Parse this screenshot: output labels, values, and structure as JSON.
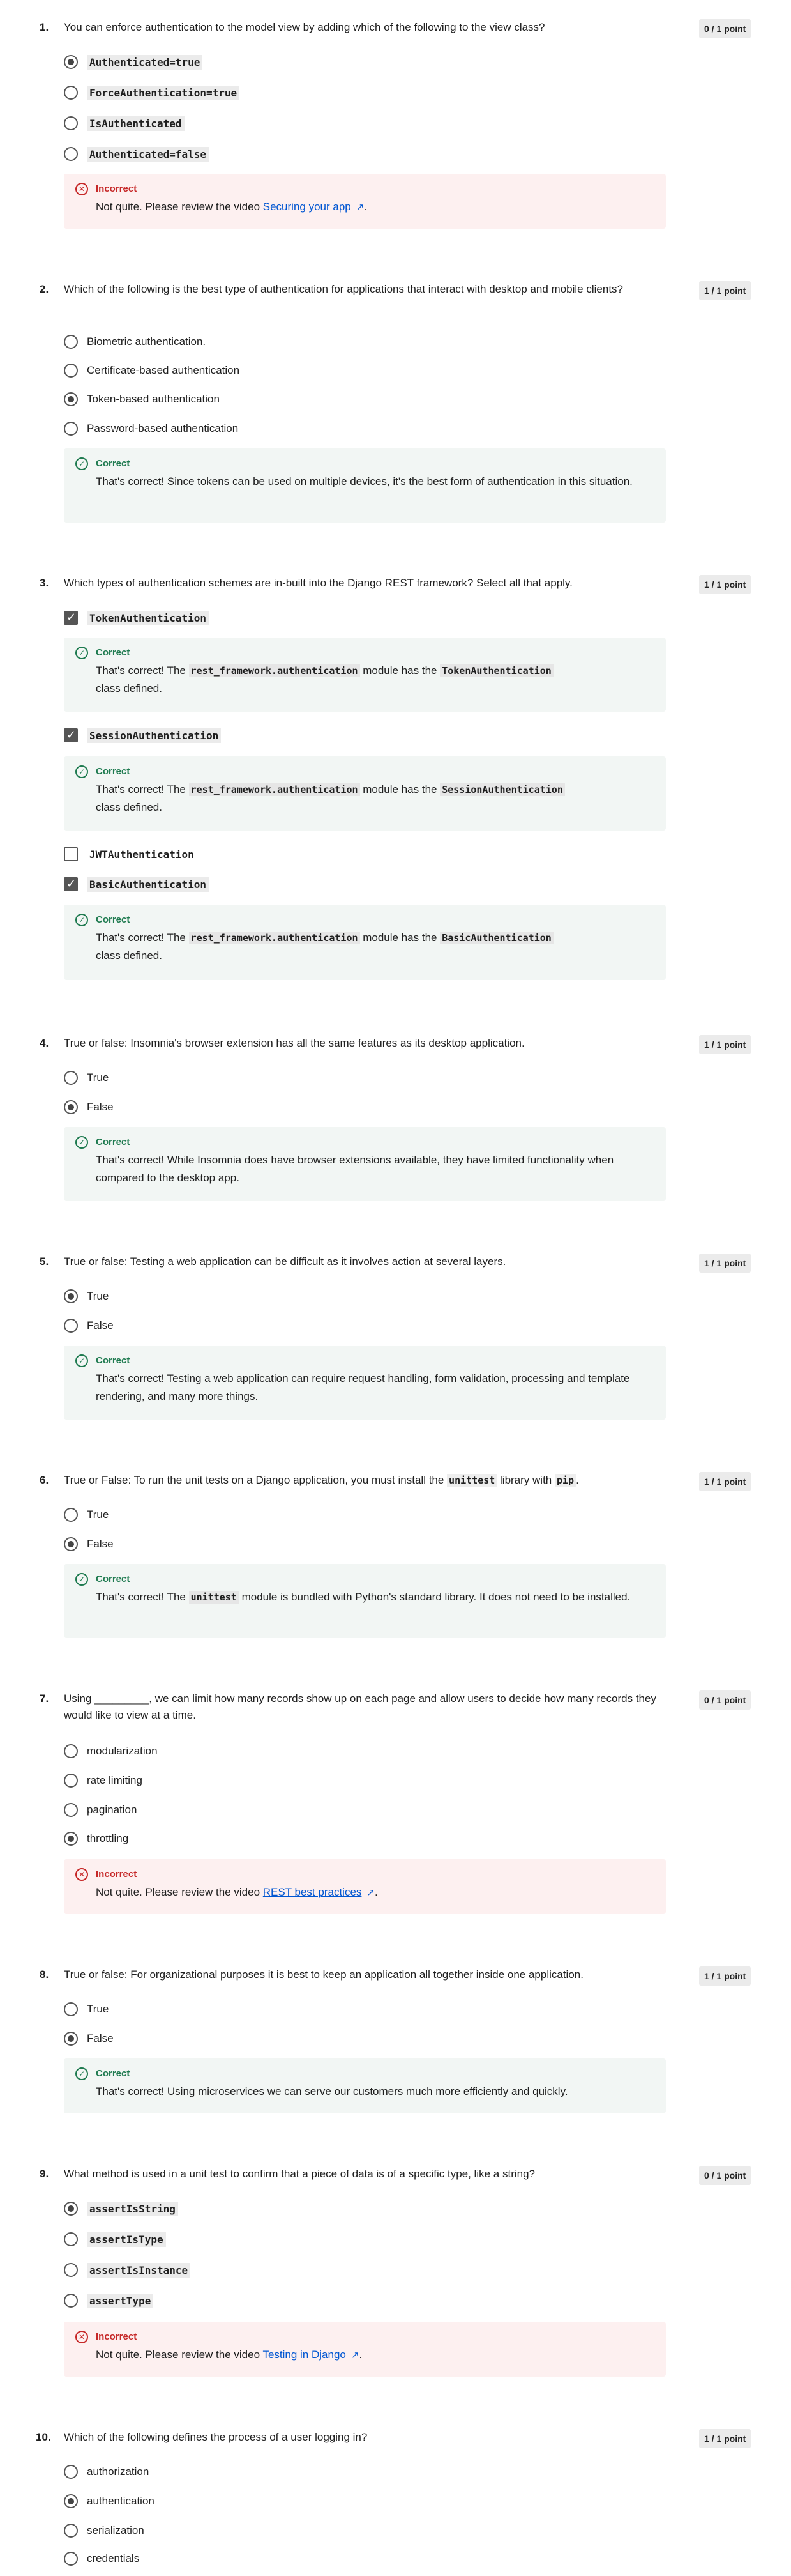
{
  "colors": {
    "correct": "#1e7a4f",
    "incorrect": "#c62828",
    "link": "#0056d2"
  },
  "questions": [
    {
      "num": "1.",
      "text": "You can enforce authentication to the model view by adding which of the following to the view class?",
      "points": "0 / 1 point",
      "options": [
        "Authenticated=true",
        "ForceAuthentication=true",
        "IsAuthenticated",
        "Authenticated=false"
      ],
      "selected": "Authenticated=true",
      "feedback": {
        "title": "Incorrect",
        "msg_prefix": "Not quite. Please review the video ",
        "link": "Securing your app",
        "msg_suffix": "."
      }
    },
    {
      "num": "2.",
      "text": "Which of the following is the best type of authentication for applications that interact with desktop and mobile clients?",
      "points": "1 / 1 point",
      "options": [
        "Biometric authentication.",
        "Certificate-based authentication",
        "Token-based authentication",
        "Password-based authentication"
      ],
      "selected": "Token-based authentication",
      "feedback": {
        "title": "Correct",
        "msg": "That's correct! Since tokens can be used on multiple devices, it's the best form of authentication in this situation."
      }
    },
    {
      "num": "3.",
      "text": "Which types of authentication schemes are in-built into the Django REST framework? Select all that apply.",
      "points": "1 / 1 point",
      "options": [
        "TokenAuthentication",
        "SessionAuthentication",
        "JWTAuthentication",
        "BasicAuthentication"
      ],
      "checked": [
        "TokenAuthentication",
        "SessionAuthentication",
        "BasicAuthentication"
      ],
      "feedback_title": "Correct",
      "feedback_prefix": "That's correct! The ",
      "feedback_module": "rest_framework.authentication",
      "feedback_middle": " module has the ",
      "feedback_suffix": "class defined."
    },
    {
      "num": "4.",
      "text": "True or false: Insomnia's browser extension has all the same features as its desktop application.",
      "points": "1 / 1 point",
      "options": [
        "True",
        "False"
      ],
      "selected": "False",
      "feedback": {
        "title": "Correct",
        "msg": "That's correct! While Insomnia does have browser extensions available, they have limited functionality when compared to the desktop app."
      }
    },
    {
      "num": "5.",
      "text": "True or false: Testing a web application can be difficult as it involves action at several layers.",
      "points": "1 / 1 point",
      "options": [
        "True",
        "False"
      ],
      "selected": "True",
      "feedback": {
        "title": "Correct",
        "msg": "That's correct! Testing a web application can require request handling, form validation, processing and template rendering, and many more things."
      }
    },
    {
      "num": "6.",
      "text_prefix": "True or False:  To run the unit tests on a Django application, you must install the ",
      "text_code1": "unittest",
      "text_middle": " library with ",
      "text_code2": "pip",
      "text_suffix": ".",
      "points": "1 / 1 point",
      "options": [
        "True",
        "False"
      ],
      "selected": "False",
      "feedback": {
        "title": "Correct",
        "msg_prefix": "That's correct! The ",
        "msg_code": "unittest",
        "msg_suffix": " module is bundled with Python's standard library. It does not need to be installed."
      }
    },
    {
      "num": "7.",
      "text": "Using _________, we can limit how many records show up on each page and allow users to decide how many records they would like to view at a time.",
      "points": "0 / 1 point",
      "options": [
        "modularization",
        "rate limiting",
        "pagination",
        "throttling"
      ],
      "selected": "throttling",
      "feedback": {
        "title": "Incorrect",
        "msg_prefix": "Not quite. Please review the video ",
        "link": "REST best practices",
        "msg_suffix": "."
      }
    },
    {
      "num": "8.",
      "text": "True or false: For organizational purposes it is best to keep an application all together inside one application.",
      "points": "1 / 1 point",
      "options": [
        "True",
        "False"
      ],
      "selected": "False",
      "feedback": {
        "title": "Correct",
        "msg": "That's correct! Using microservices we can serve our customers much more efficiently and quickly."
      }
    },
    {
      "num": "9.",
      "text": "What method is used in a unit test to confirm that a piece of data is of a specific type, like a string?",
      "points": "0 / 1 point",
      "options": [
        "assertIsString",
        "assertIsType",
        "assertIsInstance",
        "assertType"
      ],
      "selected": "assertIsString",
      "feedback": {
        "title": "Incorrect",
        "msg_prefix": "Not quite. Please review the video ",
        "link": "Testing in Django",
        "msg_suffix": "."
      }
    },
    {
      "num": "10.",
      "text": "Which of the following defines the process of a user logging in?",
      "points": "1 / 1 point",
      "options": [
        "authorization",
        "authentication",
        "serialization",
        "credentials"
      ],
      "selected": "authentication"
    }
  ]
}
